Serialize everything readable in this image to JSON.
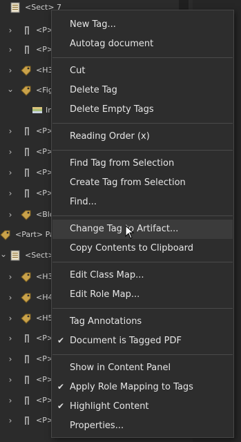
{
  "tree": {
    "rows": [
      {
        "label": "<Sect> 7",
        "chevron": "",
        "icon": "doc"
      },
      {
        "label": "<P>",
        "chevron": "›",
        "icon": "para"
      },
      {
        "label": "<P>",
        "chevron": "›",
        "icon": "para"
      },
      {
        "label": "<H3",
        "chevron": "›",
        "icon": "tag"
      },
      {
        "label": "<Fig",
        "chevron": "⌄",
        "icon": "tag"
      },
      {
        "label": "In",
        "chevron": "",
        "icon": "book"
      },
      {
        "label": "<P>",
        "chevron": "›",
        "icon": "para"
      },
      {
        "label": "<P>",
        "chevron": "›",
        "icon": "para"
      },
      {
        "label": "<P>",
        "chevron": "›",
        "icon": "para"
      },
      {
        "label": "<P>",
        "chevron": "›",
        "icon": "para"
      },
      {
        "label": "<Blo",
        "chevron": "›",
        "icon": "tag"
      },
      {
        "label": "<Part> Pa",
        "chevron": "",
        "icon": "tag"
      },
      {
        "label": "<Sect>",
        "chevron": "⌄",
        "icon": "doc"
      },
      {
        "label": "<H3",
        "chevron": "›",
        "icon": "tag"
      },
      {
        "label": "<H4",
        "chevron": "›",
        "icon": "tag"
      },
      {
        "label": "<H5",
        "chevron": "›",
        "icon": "tag"
      },
      {
        "label": "<P>",
        "chevron": "›",
        "icon": "para"
      },
      {
        "label": "<P>",
        "chevron": "›",
        "icon": "para"
      },
      {
        "label": "<P>",
        "chevron": "›",
        "icon": "para"
      },
      {
        "label": "<P>",
        "chevron": "›",
        "icon": "para"
      },
      {
        "label": "<P>",
        "chevron": "›",
        "icon": "para"
      }
    ]
  },
  "menu": {
    "items": [
      {
        "label": "New Tag...",
        "checked": false
      },
      {
        "label": "Autotag document",
        "checked": false
      },
      {
        "label": "Cut",
        "checked": false
      },
      {
        "label": "Delete Tag",
        "checked": false
      },
      {
        "label": "Delete Empty Tags",
        "checked": false
      },
      {
        "label": "Reading Order (x)",
        "checked": false
      },
      {
        "label": "Find Tag from Selection",
        "checked": false
      },
      {
        "label": "Create Tag from Selection",
        "checked": false
      },
      {
        "label": "Find...",
        "checked": false
      },
      {
        "label": "Change Tag to Artifact...",
        "checked": false,
        "highlighted": true
      },
      {
        "label": "Copy Contents to Clipboard",
        "checked": false
      },
      {
        "label": "Edit Class Map...",
        "checked": false
      },
      {
        "label": "Edit Role Map...",
        "checked": false
      },
      {
        "label": "Tag Annotations",
        "checked": false
      },
      {
        "label": "Document is Tagged PDF",
        "checked": true
      },
      {
        "label": "Show in Content Panel",
        "checked": false
      },
      {
        "label": "Apply Role Mapping to Tags",
        "checked": true
      },
      {
        "label": "Highlight Content",
        "checked": true
      },
      {
        "label": "Properties...",
        "checked": false
      }
    ],
    "check_glyph": "✔"
  },
  "colors": {
    "menu_bg": "#2d2d2d",
    "highlight": "#3b3b3b",
    "tag_icon": "#c9a24a"
  }
}
